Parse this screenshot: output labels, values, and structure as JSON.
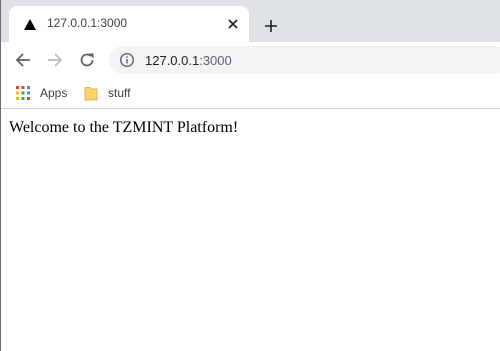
{
  "tab": {
    "title": "127.0.0.1:3000",
    "favicon": "triangle-icon"
  },
  "toolbar": {
    "url_host": "127.0.0.1",
    "url_port": ":3000"
  },
  "bookmarks": [
    {
      "label": "Apps",
      "icon": "apps-grid-icon"
    },
    {
      "label": "stuff",
      "icon": "folder-icon"
    }
  ],
  "page": {
    "text": "Welcome to the TZMINT Platform!"
  },
  "colors": {
    "tabstrip": "#dee1e6",
    "omnibox": "#f1f3f4",
    "icon": "#5f6368",
    "folder": "#fcd66b"
  }
}
